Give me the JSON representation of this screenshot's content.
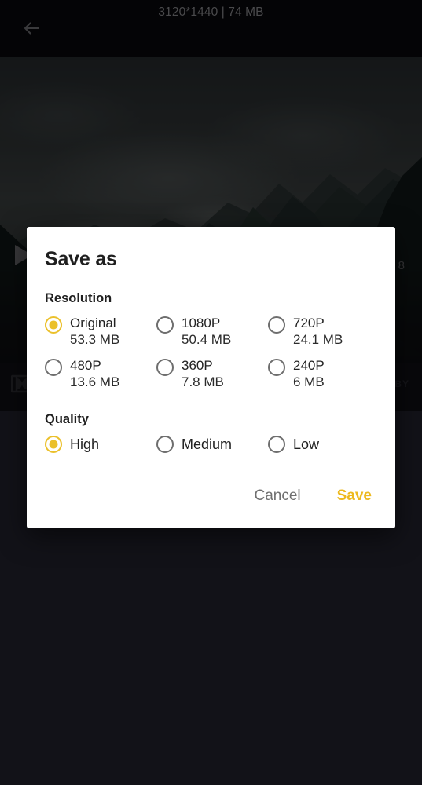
{
  "topbar": {
    "back_icon": "arrow-left-icon",
    "title": "3120*1440 | 74 MB"
  },
  "player": {
    "play_icon": "play-icon",
    "time_label": "8",
    "dolby_icon": "dolby-icon",
    "dolby_text": "DBY"
  },
  "dialog": {
    "title": "Save as",
    "resolution": {
      "label": "Resolution",
      "options": [
        {
          "label": "Original",
          "size": "53.3 MB",
          "selected": true
        },
        {
          "label": "1080P",
          "size": "50.4 MB",
          "selected": false
        },
        {
          "label": "720P",
          "size": "24.1 MB",
          "selected": false
        },
        {
          "label": "480P",
          "size": "13.6 MB",
          "selected": false
        },
        {
          "label": "360P",
          "size": "7.8 MB",
          "selected": false
        },
        {
          "label": "240P",
          "size": "6 MB",
          "selected": false
        }
      ]
    },
    "quality": {
      "label": "Quality",
      "options": [
        {
          "label": "High",
          "selected": true
        },
        {
          "label": "Medium",
          "selected": false
        },
        {
          "label": "Low",
          "selected": false
        }
      ]
    },
    "actions": {
      "cancel_label": "Cancel",
      "save_label": "Save"
    }
  },
  "colors": {
    "accent": "#EBC02A",
    "save_text": "#EDB91F",
    "dialog_bg": "#FFFFFF",
    "scrim": "#121218"
  }
}
